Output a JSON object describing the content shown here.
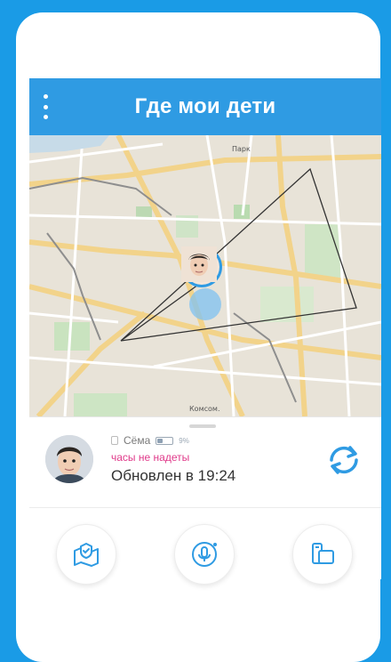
{
  "app": {
    "title": "Где мои дети"
  },
  "colors": {
    "brand": "#2f9be3",
    "background": "#1a9be6",
    "status_warning": "#e03a8a"
  },
  "header": {
    "menu_icon": "kebab-menu-icon"
  },
  "map": {
    "label_park": "Парк",
    "label_south": "Комсом.",
    "marker": "child-location-marker"
  },
  "child": {
    "name": "Сёма",
    "battery_text": "9%",
    "battery_level": 0.35,
    "status_text": "часы не надеты",
    "updated_text": "Обновлен в 19:24"
  },
  "actions": [
    {
      "name": "safe-zone",
      "icon": "map-shield-icon"
    },
    {
      "name": "listen",
      "icon": "microphone-icon"
    },
    {
      "name": "devices",
      "icon": "device-icon"
    }
  ]
}
